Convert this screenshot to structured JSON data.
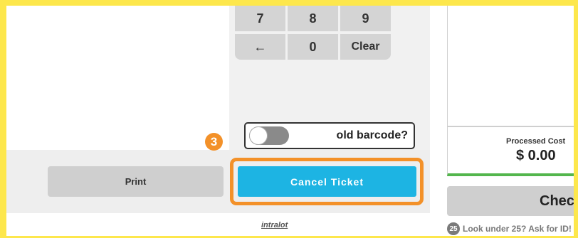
{
  "keypad": {
    "keys": [
      "7",
      "8",
      "9",
      "←",
      "0",
      "Clear"
    ]
  },
  "toggle": {
    "label": "old barcode?",
    "state": "off"
  },
  "step_badge": "3",
  "buttons": {
    "print": "Print",
    "cancel_ticket": "Cancel Ticket",
    "check": "Chec"
  },
  "brand": "intralot",
  "cost": {
    "label": "Processed Cost",
    "value": "$ 0.00"
  },
  "age_notice": {
    "badge": "25",
    "text": "Look under 25? Ask for ID!"
  },
  "colors": {
    "frame": "#fde74c",
    "accent_orange": "#f39129",
    "cancel_blue": "#1db4e3",
    "success_green": "#53b64d"
  }
}
